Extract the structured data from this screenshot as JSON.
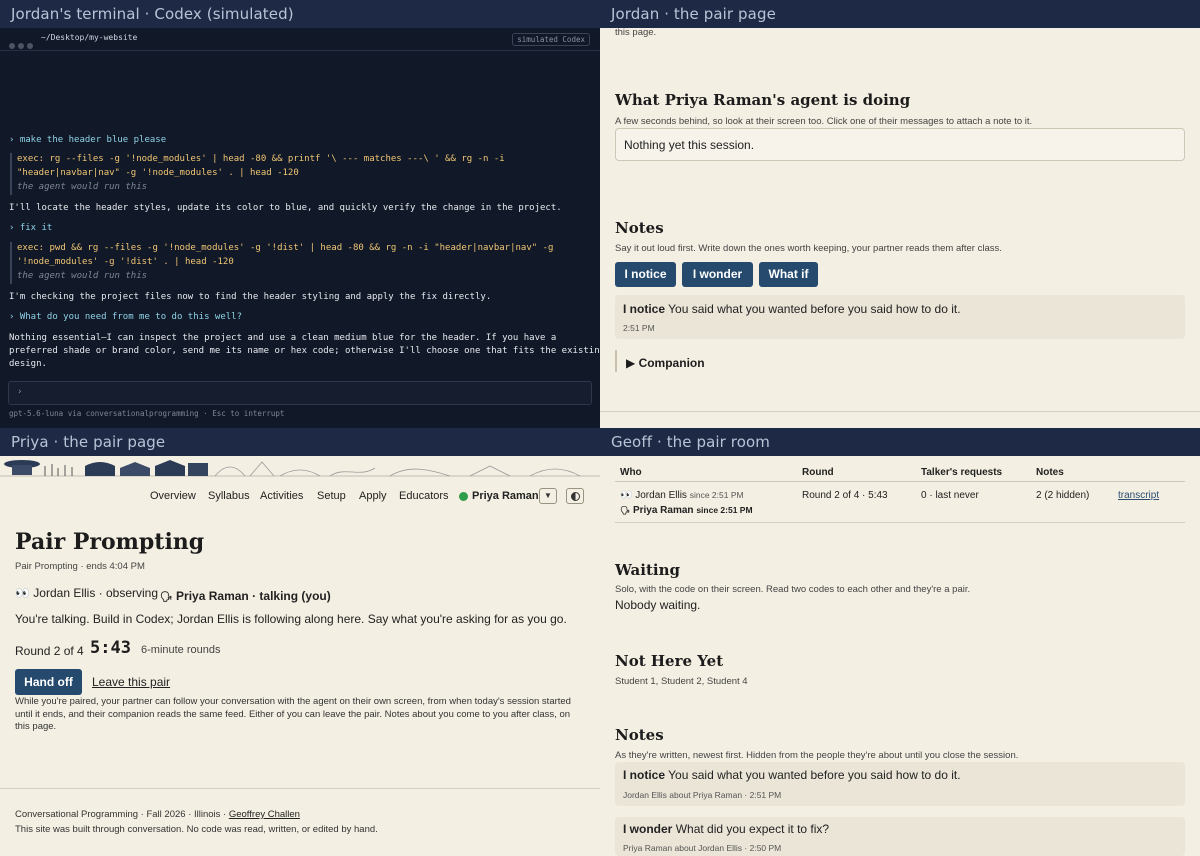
{
  "terminal": {
    "title": "Jordan's terminal · Codex (simulated)",
    "path": "~/Desktop/my-website",
    "badge": "simulated Codex",
    "lines": {
      "p1": "› make the header blue please",
      "e1a": "exec: rg --files -g '!node_modules' | head -80 && printf '\\ --- matches ---\\ ' && rg -n -i",
      "e1b": "\"header|navbar|nav\" -g '!node_modules' . | head -120",
      "e1c": "the agent would run this",
      "r1": "I'll locate the header styles, update its color to blue, and quickly verify the change in the project.",
      "p2": "› fix it",
      "e2a": "exec: pwd && rg --files -g '!node_modules' -g '!dist' | head -80 && rg -n -i \"header|navbar|nav\" -g",
      "e2b": "'!node_modules' -g '!dist' . | head -120",
      "e2c": "the agent would run this",
      "r2": "I'm checking the project files now to find the header styling and apply the fix directly.",
      "p3": "› What do you need from me to do this well?",
      "r3a": "Nothing essential—I can inspect the project and use a clean medium blue for the header. If you have a",
      "r3b": "preferred shade or brand color, send me its name or hex code; otherwise I'll choose one that fits the existing",
      "r3c": "design."
    },
    "input_prompt": "›",
    "status": "gpt-5.6-luna via conversationalprogramming  ·  Esc to interrupt"
  },
  "jordan": {
    "title": "Jordan · the pair page",
    "top_fragment": "this page.",
    "agent_heading": "What Priya Raman's agent is doing",
    "agent_sub": "A few seconds behind, so look at their screen too. Click one of their messages to attach a note to it.",
    "agent_box": "Nothing yet this session.",
    "notes_heading": "Notes",
    "notes_sub": "Say it out loud first. Write down the ones worth keeping, your partner reads them after class.",
    "buttons": [
      "I notice",
      "I wonder",
      "What if"
    ],
    "note": {
      "kind": "I notice",
      "text": "You said what you wanted before you said how to do it.",
      "time": "2:51 PM"
    },
    "companion": "▶ Companion"
  },
  "priya": {
    "title": "Priya · the pair page",
    "nav": [
      "Overview",
      "Syllabus",
      "Activities",
      "Setup",
      "Apply",
      "Educators"
    ],
    "user": "Priya Raman",
    "page_title": "Pair Prompting",
    "page_sub": "Pair Prompting · ends 4:04 PM",
    "observer": "Jordan Ellis · observing",
    "talker": "Priya Raman · talking (you)",
    "instructions": "You're talking. Build in Codex; Jordan Ellis is following along here. Say what you're asking for as you go.",
    "round_label": "Round 2 of 4",
    "timer": "5:43",
    "round_len": "6-minute rounds",
    "hand_off": "Hand off",
    "leave": "Leave this pair",
    "explain": "While you're paired, your partner can follow your conversation with the agent on their own screen, from when today's session started until it ends, and their companion reads the same feed. Either of you can leave the pair. Notes about you come to you after class, on this page.",
    "footer_a": "Conversational Programming · Fall 2026 · Illinois ·",
    "footer_link": "Geoffrey Challen",
    "footer_b": "This site was built through conversation. No code was read, written, or edited by hand."
  },
  "geoff": {
    "title": "Geoff · the pair room",
    "columns": [
      "Who",
      "Round",
      "Talker's requests",
      "Notes"
    ],
    "row": {
      "who1": "Jordan Ellis",
      "since1": "since 2:51 PM",
      "who2": "Priya Raman",
      "since2": "since 2:51 PM",
      "round": "Round 2 of 4 · 5:43",
      "requests": "0 · last never",
      "notes": "2 (2 hidden)",
      "link": "transcript"
    },
    "waiting_heading": "Waiting",
    "waiting_sub": "Solo, with the code on their screen. Read two codes to each other and they're a pair.",
    "waiting_body": "Nobody waiting.",
    "nothere_heading": "Not Here Yet",
    "nothere_body": "Student 1, Student 2, Student 4",
    "notes_heading": "Notes",
    "notes_sub": "As they're written, newest first. Hidden from the people they're about until you close the session.",
    "notes": [
      {
        "kind": "I notice",
        "text": "You said what you wanted before you said how to do it.",
        "meta": "Jordan Ellis about Priya Raman · 2:51 PM"
      },
      {
        "kind": "I wonder",
        "text": "What did you expect it to fix?",
        "meta": "Priya Raman about Jordan Ellis · 2:50 PM"
      }
    ]
  }
}
